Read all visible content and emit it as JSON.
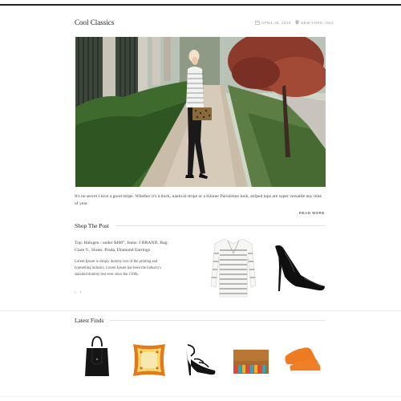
{
  "post": {
    "title": "Cool Classics",
    "date": "APRIL 28, 2016",
    "location": "NEW YORK, USA",
    "intro": "It's no secret I love a good stripe. Whether it's a thick, nautical stripe or a thinner Parisienne look, striped tops are super versatile any time of year.",
    "read_more": "READ MORE"
  },
  "shop": {
    "title": "Shop The Post",
    "product_line": "Top: Halogen / under $400°, Jeans: J BRAND, Bag: Clare V., Shoes: Prada, Diamond Earrings",
    "description": "Lorem Ipsum is simply dummy text of the printing and typesetting industry. Lorem Ipsum has been the industry's standard dummy text ever since the 1500s.",
    "prev": "‹",
    "next": "›"
  },
  "finds": {
    "title": "Latest Finds"
  },
  "icons": {
    "date": "calendar-icon",
    "location": "map-pin-icon"
  },
  "colors": {
    "text": "#222222",
    "muted": "#999999",
    "rule": "#e3e3e3",
    "accent_orange": "#e8781e"
  }
}
